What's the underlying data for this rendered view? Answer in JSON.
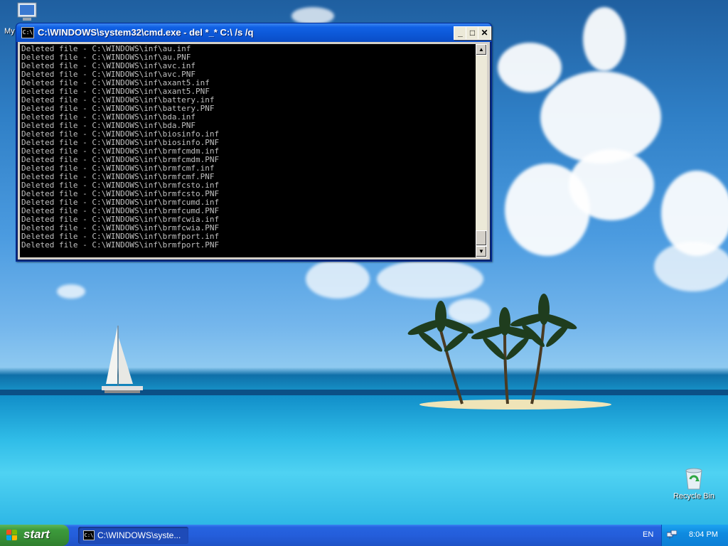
{
  "desktop": {
    "icons": {
      "my_computer_label": "My",
      "recycle_bin_label": "Recycle Bin"
    }
  },
  "cmd_window": {
    "title": "C:\\WINDOWS\\system32\\cmd.exe - del *_* C:\\ /s /q",
    "icon_text": "C:\\",
    "buttons": {
      "minimize": "_",
      "maximize": "□",
      "close": "✕"
    },
    "lines": [
      "Deleted file - C:\\WINDOWS\\inf\\au.inf",
      "Deleted file - C:\\WINDOWS\\inf\\au.PNF",
      "Deleted file - C:\\WINDOWS\\inf\\avc.inf",
      "Deleted file - C:\\WINDOWS\\inf\\avc.PNF",
      "Deleted file - C:\\WINDOWS\\inf\\axant5.inf",
      "Deleted file - C:\\WINDOWS\\inf\\axant5.PNF",
      "Deleted file - C:\\WINDOWS\\inf\\battery.inf",
      "Deleted file - C:\\WINDOWS\\inf\\battery.PNF",
      "Deleted file - C:\\WINDOWS\\inf\\bda.inf",
      "Deleted file - C:\\WINDOWS\\inf\\bda.PNF",
      "Deleted file - C:\\WINDOWS\\inf\\biosinfo.inf",
      "Deleted file - C:\\WINDOWS\\inf\\biosinfo.PNF",
      "Deleted file - C:\\WINDOWS\\inf\\brmfcmdm.inf",
      "Deleted file - C:\\WINDOWS\\inf\\brmfcmdm.PNF",
      "Deleted file - C:\\WINDOWS\\inf\\brmfcmf.inf",
      "Deleted file - C:\\WINDOWS\\inf\\brmfcmf.PNF",
      "Deleted file - C:\\WINDOWS\\inf\\brmfcsto.inf",
      "Deleted file - C:\\WINDOWS\\inf\\brmfcsto.PNF",
      "Deleted file - C:\\WINDOWS\\inf\\brmfcumd.inf",
      "Deleted file - C:\\WINDOWS\\inf\\brmfcumd.PNF",
      "Deleted file - C:\\WINDOWS\\inf\\brmfcwia.inf",
      "Deleted file - C:\\WINDOWS\\inf\\brmfcwia.PNF",
      "Deleted file - C:\\WINDOWS\\inf\\brmfport.inf",
      "Deleted file - C:\\WINDOWS\\inf\\brmfport.PNF"
    ],
    "scrollbar": {
      "up_glyph": "▲",
      "down_glyph": "▼"
    }
  },
  "taskbar": {
    "start_label": "start",
    "task_button_label": "C:\\WINDOWS\\syste...",
    "language": "EN",
    "clock": "8:04 PM"
  },
  "colors": {
    "titlebar_blue": "#0c57d6",
    "taskbar_blue": "#245edb",
    "start_green": "#3c9a3b",
    "console_text": "#c0c0c0"
  }
}
